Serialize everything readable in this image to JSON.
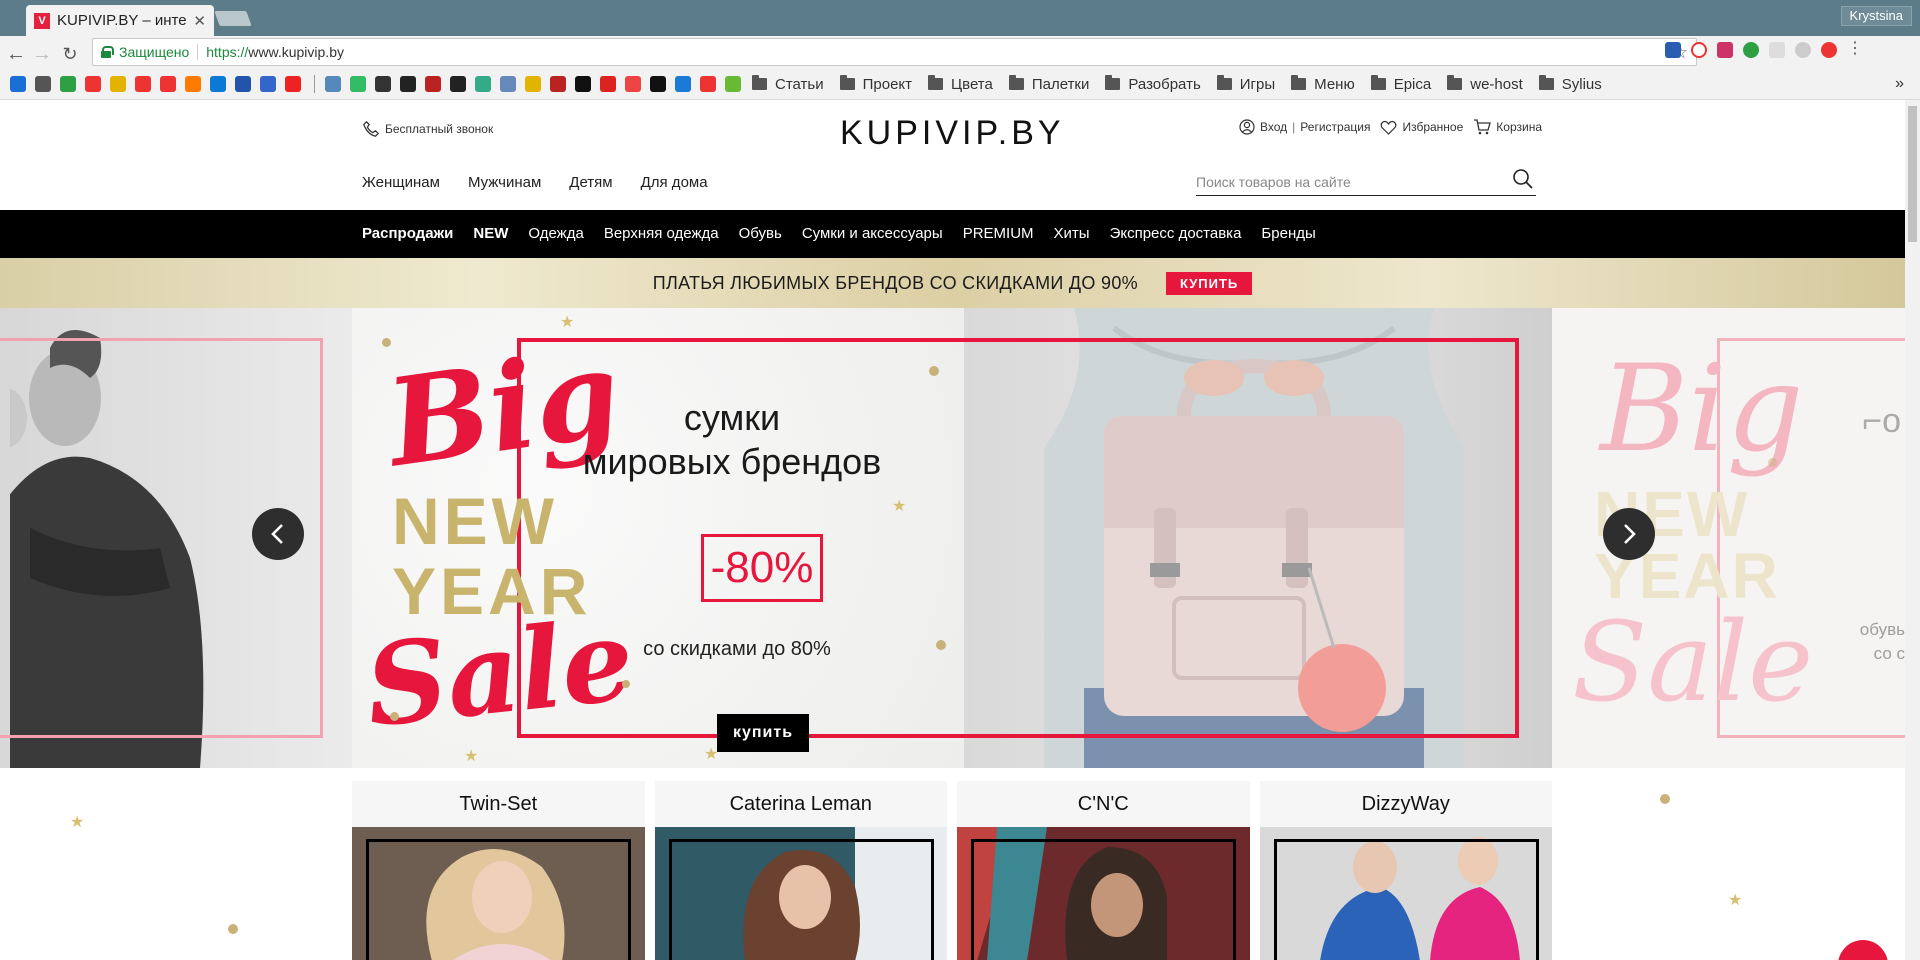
{
  "browser": {
    "tab_title": "KUPIVIP.BY – инте",
    "tab_favicon": "V",
    "user": "Krystsina",
    "secure_label": "Защищено",
    "url_proto": "https://",
    "url_host": "www.kupivip.by",
    "bookmark_folders": [
      "Статьи",
      "Проект",
      "Цвета",
      "Палетки",
      "Разобрать",
      "Игры",
      "Меню",
      "Epica",
      "we-host",
      "Sylius"
    ],
    "bookmark_icon_colors": [
      "#1a6fd6",
      "#555",
      "#2ea043",
      "#e33",
      "#e4b300",
      "#e33",
      "#e33",
      "#ff7a00",
      "#0a7ad6",
      "#25a",
      "#36c",
      "#e22"
    ],
    "bookmark_icons2_colors": [
      "#58b",
      "#3b6",
      "#333",
      "#222",
      "#b22",
      "#222",
      "#3a8",
      "#68b",
      "#e2b400",
      "#b22",
      "#111",
      "#d22",
      "#e44",
      "#111",
      "#1a7ad6",
      "#e33",
      "#6b3"
    ]
  },
  "header": {
    "free_call": "Бесплатный звонок",
    "logo": "KUPIVIP.BY",
    "login": "Вход",
    "register": "Регистрация",
    "favorites": "Избранное",
    "cart": "Корзина",
    "gender_nav": [
      "Женщинам",
      "Мужчинам",
      "Детям",
      "Для дома"
    ],
    "search_placeholder": "Поиск товаров на сайте"
  },
  "categories": [
    {
      "label": "Распродажи",
      "bold": true
    },
    {
      "label": "NEW",
      "bold": true
    },
    {
      "label": "Одежда",
      "bold": false
    },
    {
      "label": "Верхняя одежда",
      "bold": false
    },
    {
      "label": "Обувь",
      "bold": false
    },
    {
      "label": "Сумки и аксессуары",
      "bold": false
    },
    {
      "label": "PREMIUM",
      "bold": false
    },
    {
      "label": "Хиты",
      "bold": false
    },
    {
      "label": "Экспресс доставка",
      "bold": false
    },
    {
      "label": "Бренды",
      "bold": false
    }
  ],
  "promo": {
    "text": "ПЛАТЬЯ ЛЮБИМЫХ БРЕНДОВ СО СКИДКАМИ ДО 90%",
    "button": "КУПИТЬ"
  },
  "hero": {
    "big": "Big",
    "new": "NEW",
    "year": "YEAR",
    "sale": "Sale",
    "headline_1": "сумки",
    "headline_2": "мировых брендов",
    "discount": "-80%",
    "subline": "со скидками до 80%",
    "button": "купить",
    "next_slide_text_1": "обувь",
    "next_slide_text_2": "со с"
  },
  "brands": [
    "Twin-Set",
    "Caterina Leman",
    "C'N'C",
    "DizzyWay"
  ],
  "colors": {
    "accent_red": "#e6163c",
    "gold": "#c9b46e",
    "black": "#000000"
  }
}
